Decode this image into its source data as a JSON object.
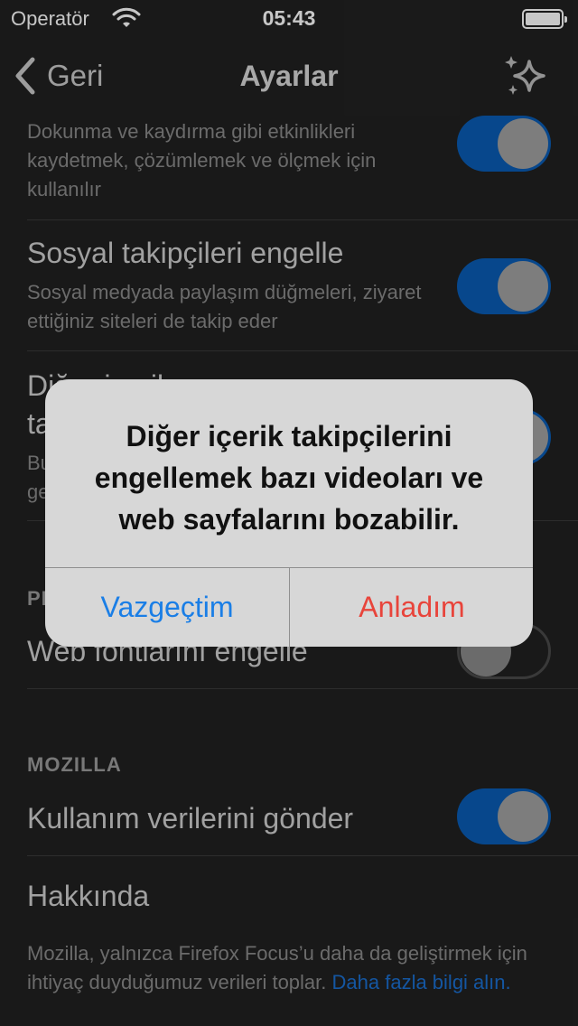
{
  "status_bar": {
    "carrier": "Operatör",
    "time": "05:43"
  },
  "nav": {
    "back_label": "Geri",
    "title": "Ayarlar",
    "sparkle_icon": "sparkle-icon"
  },
  "settings": {
    "analytics_desc": "Dokunma ve kaydırma gibi etkinlikleri kaydetmek, çözümlemek ve ölçmek için kullanılır",
    "social": {
      "title": "Sosyal takipçileri engelle",
      "desc": "Sosyal medyada paylaşım düğmeleri, ziyaret ettiğiniz siteleri de takip eder",
      "enabled": true
    },
    "other_content": {
      "title_line1": "Diğer içerik",
      "title_line2": "ta",
      "desc_line1": "Bu",
      "desc_line2": "ge",
      "enabled": true
    },
    "perf_section_header": "PE",
    "web_fonts": {
      "title": "Web fontlarını engelle",
      "enabled": false
    },
    "mozilla_section_header": "MOZILLA",
    "send_usage": {
      "title": "Kullanım verilerini gönder",
      "enabled": true
    },
    "about": {
      "title": "Hakkında"
    },
    "footer": {
      "text": "Mozilla, yalnızca Firefox Focus’u daha da geliştirmek için ihtiyaç duyduğumuz verileri toplar.",
      "link": "Daha fazla bilgi alın."
    }
  },
  "alert": {
    "message": "Diğer içerik takipçilerini engellemek bazı videoları ve web sayfalarını bozabilir.",
    "cancel_label": "Vazgeçtim",
    "confirm_label": "Anladım"
  },
  "colors": {
    "background": "#212121",
    "toggle_on": "#0a5cb4",
    "cancel_blue": "#1a7ee6",
    "confirm_red": "#e8443b",
    "link_blue": "#1a6fd0"
  }
}
